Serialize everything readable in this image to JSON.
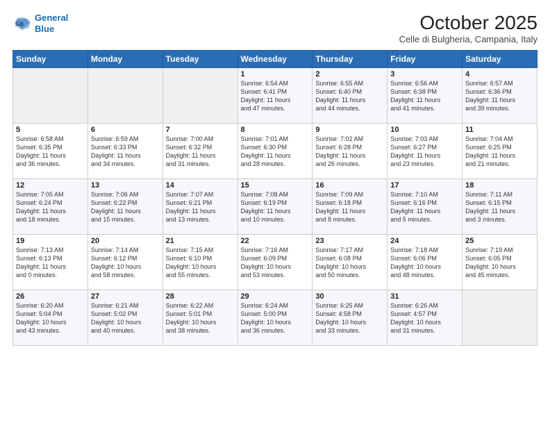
{
  "header": {
    "logo_line1": "General",
    "logo_line2": "Blue",
    "month": "October 2025",
    "location": "Celle di Bulgheria, Campania, Italy"
  },
  "weekdays": [
    "Sunday",
    "Monday",
    "Tuesday",
    "Wednesday",
    "Thursday",
    "Friday",
    "Saturday"
  ],
  "weeks": [
    [
      {
        "num": "",
        "info": ""
      },
      {
        "num": "",
        "info": ""
      },
      {
        "num": "",
        "info": ""
      },
      {
        "num": "1",
        "info": "Sunrise: 6:54 AM\nSunset: 6:41 PM\nDaylight: 11 hours\nand 47 minutes."
      },
      {
        "num": "2",
        "info": "Sunrise: 6:55 AM\nSunset: 6:40 PM\nDaylight: 11 hours\nand 44 minutes."
      },
      {
        "num": "3",
        "info": "Sunrise: 6:56 AM\nSunset: 6:38 PM\nDaylight: 11 hours\nand 41 minutes."
      },
      {
        "num": "4",
        "info": "Sunrise: 6:57 AM\nSunset: 6:36 PM\nDaylight: 11 hours\nand 39 minutes."
      }
    ],
    [
      {
        "num": "5",
        "info": "Sunrise: 6:58 AM\nSunset: 6:35 PM\nDaylight: 11 hours\nand 36 minutes."
      },
      {
        "num": "6",
        "info": "Sunrise: 6:59 AM\nSunset: 6:33 PM\nDaylight: 11 hours\nand 34 minutes."
      },
      {
        "num": "7",
        "info": "Sunrise: 7:00 AM\nSunset: 6:32 PM\nDaylight: 11 hours\nand 31 minutes."
      },
      {
        "num": "8",
        "info": "Sunrise: 7:01 AM\nSunset: 6:30 PM\nDaylight: 11 hours\nand 28 minutes."
      },
      {
        "num": "9",
        "info": "Sunrise: 7:02 AM\nSunset: 6:28 PM\nDaylight: 11 hours\nand 26 minutes."
      },
      {
        "num": "10",
        "info": "Sunrise: 7:03 AM\nSunset: 6:27 PM\nDaylight: 11 hours\nand 23 minutes."
      },
      {
        "num": "11",
        "info": "Sunrise: 7:04 AM\nSunset: 6:25 PM\nDaylight: 11 hours\nand 21 minutes."
      }
    ],
    [
      {
        "num": "12",
        "info": "Sunrise: 7:05 AM\nSunset: 6:24 PM\nDaylight: 11 hours\nand 18 minutes."
      },
      {
        "num": "13",
        "info": "Sunrise: 7:06 AM\nSunset: 6:22 PM\nDaylight: 11 hours\nand 15 minutes."
      },
      {
        "num": "14",
        "info": "Sunrise: 7:07 AM\nSunset: 6:21 PM\nDaylight: 11 hours\nand 13 minutes."
      },
      {
        "num": "15",
        "info": "Sunrise: 7:08 AM\nSunset: 6:19 PM\nDaylight: 11 hours\nand 10 minutes."
      },
      {
        "num": "16",
        "info": "Sunrise: 7:09 AM\nSunset: 6:18 PM\nDaylight: 11 hours\nand 8 minutes."
      },
      {
        "num": "17",
        "info": "Sunrise: 7:10 AM\nSunset: 6:16 PM\nDaylight: 11 hours\nand 5 minutes."
      },
      {
        "num": "18",
        "info": "Sunrise: 7:11 AM\nSunset: 6:15 PM\nDaylight: 11 hours\nand 3 minutes."
      }
    ],
    [
      {
        "num": "19",
        "info": "Sunrise: 7:13 AM\nSunset: 6:13 PM\nDaylight: 11 hours\nand 0 minutes."
      },
      {
        "num": "20",
        "info": "Sunrise: 7:14 AM\nSunset: 6:12 PM\nDaylight: 10 hours\nand 58 minutes."
      },
      {
        "num": "21",
        "info": "Sunrise: 7:15 AM\nSunset: 6:10 PM\nDaylight: 10 hours\nand 55 minutes."
      },
      {
        "num": "22",
        "info": "Sunrise: 7:16 AM\nSunset: 6:09 PM\nDaylight: 10 hours\nand 53 minutes."
      },
      {
        "num": "23",
        "info": "Sunrise: 7:17 AM\nSunset: 6:08 PM\nDaylight: 10 hours\nand 50 minutes."
      },
      {
        "num": "24",
        "info": "Sunrise: 7:18 AM\nSunset: 6:06 PM\nDaylight: 10 hours\nand 48 minutes."
      },
      {
        "num": "25",
        "info": "Sunrise: 7:19 AM\nSunset: 6:05 PM\nDaylight: 10 hours\nand 45 minutes."
      }
    ],
    [
      {
        "num": "26",
        "info": "Sunrise: 6:20 AM\nSunset: 5:04 PM\nDaylight: 10 hours\nand 43 minutes."
      },
      {
        "num": "27",
        "info": "Sunrise: 6:21 AM\nSunset: 5:02 PM\nDaylight: 10 hours\nand 40 minutes."
      },
      {
        "num": "28",
        "info": "Sunrise: 6:22 AM\nSunset: 5:01 PM\nDaylight: 10 hours\nand 38 minutes."
      },
      {
        "num": "29",
        "info": "Sunrise: 6:24 AM\nSunset: 5:00 PM\nDaylight: 10 hours\nand 36 minutes."
      },
      {
        "num": "30",
        "info": "Sunrise: 6:25 AM\nSunset: 4:58 PM\nDaylight: 10 hours\nand 33 minutes."
      },
      {
        "num": "31",
        "info": "Sunrise: 6:26 AM\nSunset: 4:57 PM\nDaylight: 10 hours\nand 31 minutes."
      },
      {
        "num": "",
        "info": ""
      }
    ]
  ]
}
